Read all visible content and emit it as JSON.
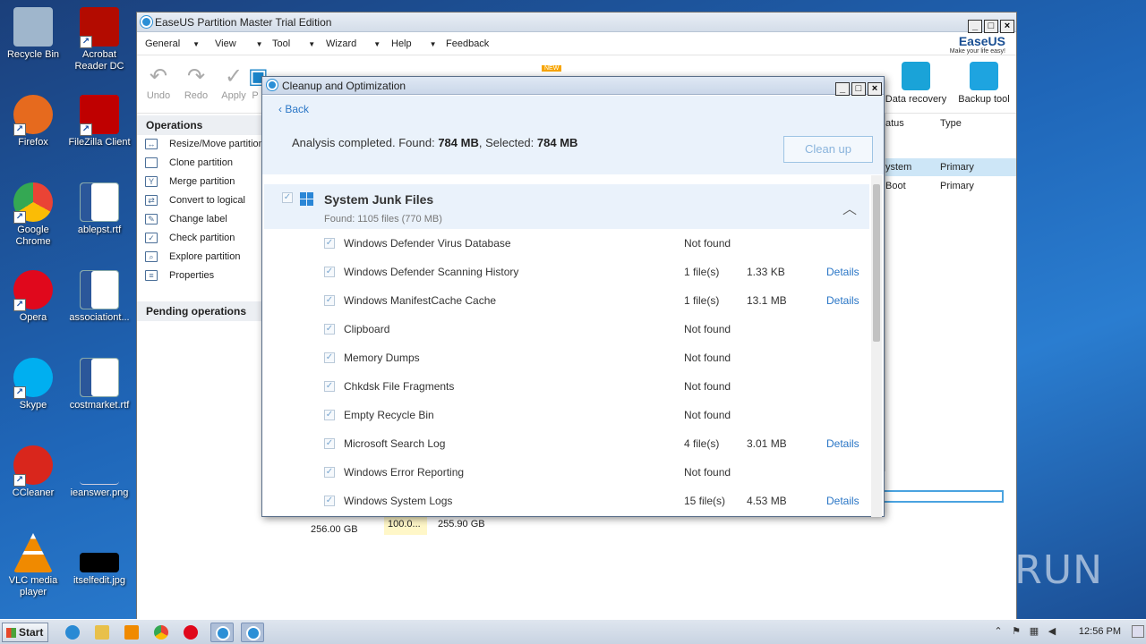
{
  "desktop": {
    "icons": [
      {
        "label": "Recycle Bin",
        "icon": "recycle-bin-icon",
        "color": "#9fb6cc"
      },
      {
        "label": "Acrobat Reader DC",
        "icon": "acrobat-icon",
        "color": "#b30b00"
      },
      {
        "label": "Firefox",
        "icon": "firefox-icon",
        "color": "#e66a1e"
      },
      {
        "label": "FileZilla Client",
        "icon": "filezilla-icon",
        "color": "#bf0000"
      },
      {
        "label": "Google Chrome",
        "icon": "chrome-icon",
        "color": "#34a853"
      },
      {
        "label": "ablepst.rtf",
        "icon": "word-doc-icon",
        "color": "#2b579a"
      },
      {
        "label": "Opera",
        "icon": "opera-icon",
        "color": "#e0081c"
      },
      {
        "label": "associationt...",
        "icon": "word-doc-icon",
        "color": "#2b579a"
      },
      {
        "label": "Skype",
        "icon": "skype-icon",
        "color": "#00aff0"
      },
      {
        "label": "costmarket.rtf",
        "icon": "word-doc-icon",
        "color": "#2b579a"
      },
      {
        "label": "CCleaner",
        "icon": "ccleaner-icon",
        "color": "#d9261c"
      },
      {
        "label": "ieanswer.png",
        "icon": "image-file-icon",
        "color": "#3d78c8"
      },
      {
        "label": "VLC media player",
        "icon": "vlc-icon",
        "color": "#f08a00"
      },
      {
        "label": "itselfedit.jpg",
        "icon": "image-file-icon",
        "color": "#000000"
      }
    ],
    "watermark": "ANY RUN"
  },
  "taskbar": {
    "start_label": "Start",
    "clock": "12:56 PM"
  },
  "main_window": {
    "title": "EaseUS Partition Master Trial Edition",
    "menu": [
      "General",
      "View",
      "Tool",
      "Wizard",
      "Help",
      "Feedback"
    ],
    "logo": "EaseUS",
    "logo_tagline": "Make your life easy!",
    "toolbar": {
      "undo": "Undo",
      "redo": "Redo",
      "apply": "Apply",
      "partial": "P",
      "new_badge": "NEW"
    },
    "right_tools": [
      {
        "label": "Data recovery",
        "icon": "data-recovery-icon"
      },
      {
        "label": "Backup tool",
        "icon": "backup-tool-icon"
      }
    ],
    "operations_title": "Operations",
    "operations": [
      "Resize/Move partition",
      "Clone partition",
      "Merge partition",
      "Convert to logical",
      "Change label",
      "Check partition",
      "Explore partition",
      "Properties"
    ],
    "pending_title": "Pending operations",
    "columns": {
      "status": "atus",
      "type": "Type"
    },
    "partitions": [
      {
        "status": "ystem",
        "type": "Primary"
      },
      {
        "status": "Boot",
        "type": "Primary"
      }
    ],
    "disk": {
      "size": "256.00 GB",
      "seg1": "100.0...",
      "seg2": "255.90 GB"
    }
  },
  "dialog": {
    "title": "Cleanup and Optimization",
    "back": "Back",
    "summary_prefix": "Analysis completed. Found: ",
    "found": "784 MB",
    "summary_mid": ", Selected: ",
    "selected": "784 MB",
    "cleanup_button": "Clean up",
    "category": {
      "title": "System Junk Files",
      "subtitle": "Found: 1105 files (770 MB)"
    },
    "items": [
      {
        "name": "Windows Defender Virus Database",
        "status": "Not found",
        "size": "",
        "details": ""
      },
      {
        "name": "Windows Defender Scanning History",
        "status": "1 file(s)",
        "size": "1.33 KB",
        "details": "Details"
      },
      {
        "name": "Windows ManifestCache Cache",
        "status": "1 file(s)",
        "size": "13.1 MB",
        "details": "Details"
      },
      {
        "name": "Clipboard",
        "status": "Not found",
        "size": "",
        "details": ""
      },
      {
        "name": "Memory Dumps",
        "status": "Not found",
        "size": "",
        "details": ""
      },
      {
        "name": "Chkdsk File Fragments",
        "status": "Not found",
        "size": "",
        "details": ""
      },
      {
        "name": "Empty Recycle Bin",
        "status": "Not found",
        "size": "",
        "details": ""
      },
      {
        "name": "Microsoft Search Log",
        "status": "4 file(s)",
        "size": "3.01 MB",
        "details": "Details"
      },
      {
        "name": "Windows Error Reporting",
        "status": "Not found",
        "size": "",
        "details": ""
      },
      {
        "name": "Windows System Logs",
        "status": "15 file(s)",
        "size": "4.53 MB",
        "details": "Details"
      }
    ]
  }
}
